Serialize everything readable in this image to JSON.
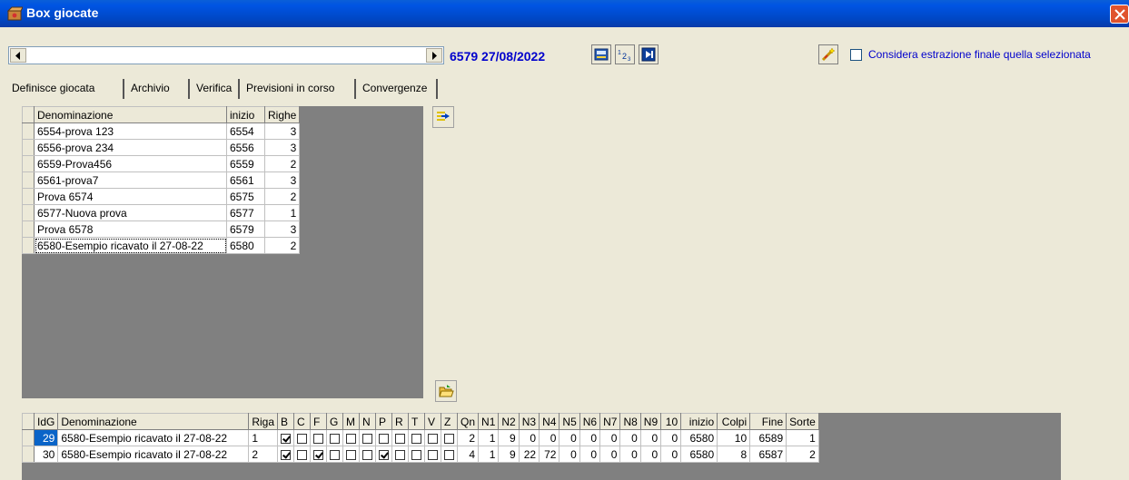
{
  "window": {
    "title": "Box giocate"
  },
  "toolbar": {
    "record": "6579 27/08/2022",
    "final_check_label": "Considera estrazione finale quella selezionata",
    "final_check_checked": false,
    "buttons": [
      "calculator-icon",
      "numbering-icon",
      "step-icon",
      "wand-icon"
    ]
  },
  "tabs": [
    {
      "label": "Definisce giocata",
      "active": false
    },
    {
      "label": "Archivio",
      "active": true
    },
    {
      "label": "Verifica",
      "active": false
    },
    {
      "label": "Previsioni in corso",
      "active": false
    },
    {
      "label": "Convergenze",
      "active": false
    }
  ],
  "archive": {
    "headers": [
      "Denominazione",
      "inizio",
      "Righe"
    ],
    "rows": [
      [
        "6554-prova 123",
        "6554",
        "3"
      ],
      [
        "6556-prova 234",
        "6556",
        "3"
      ],
      [
        "6559-Prova456",
        "6559",
        "2"
      ],
      [
        "6561-prova7",
        "6561",
        "3"
      ],
      [
        "Prova 6574",
        "6575",
        "2"
      ],
      [
        "6577-Nuova prova",
        "6577",
        "1"
      ],
      [
        "Prova 6578",
        "6579",
        "3"
      ],
      [
        "6580-Esempio ricavato il 27-08-22",
        "6580",
        "2"
      ]
    ]
  },
  "detail": {
    "headers": [
      "IdG",
      "Denominazione",
      "Riga",
      "B",
      "C",
      "F",
      "G",
      "M",
      "N",
      "P",
      "R",
      "T",
      "V",
      "Z",
      "Qn",
      "N1",
      "N2",
      "N3",
      "N4",
      "N5",
      "N6",
      "N7",
      "N8",
      "N9",
      "10",
      "inizio",
      "Colpi",
      "Fine",
      "Sorte"
    ],
    "rows": [
      {
        "idg": "29",
        "name": "6580-Esempio ricavato il 27-08-22",
        "riga": "1",
        "checks": [
          true,
          false,
          false,
          false,
          false,
          false,
          false,
          false,
          false,
          false,
          false
        ],
        "nums": [
          "2",
          "1",
          "9",
          "0",
          "0",
          "0",
          "0",
          "0",
          "0",
          "0",
          "0"
        ],
        "inizio": "6580",
        "colpi": "10",
        "fine": "6589",
        "sorte": "1"
      },
      {
        "idg": "30",
        "name": "6580-Esempio ricavato il 27-08-22",
        "riga": "2",
        "checks": [
          true,
          false,
          true,
          false,
          false,
          false,
          true,
          false,
          false,
          false,
          false
        ],
        "nums": [
          "4",
          "1",
          "9",
          "22",
          "72",
          "0",
          "0",
          "0",
          "0",
          "0",
          "0"
        ],
        "inizio": "6580",
        "colpi": "8",
        "fine": "6587",
        "sorte": "2"
      }
    ]
  }
}
